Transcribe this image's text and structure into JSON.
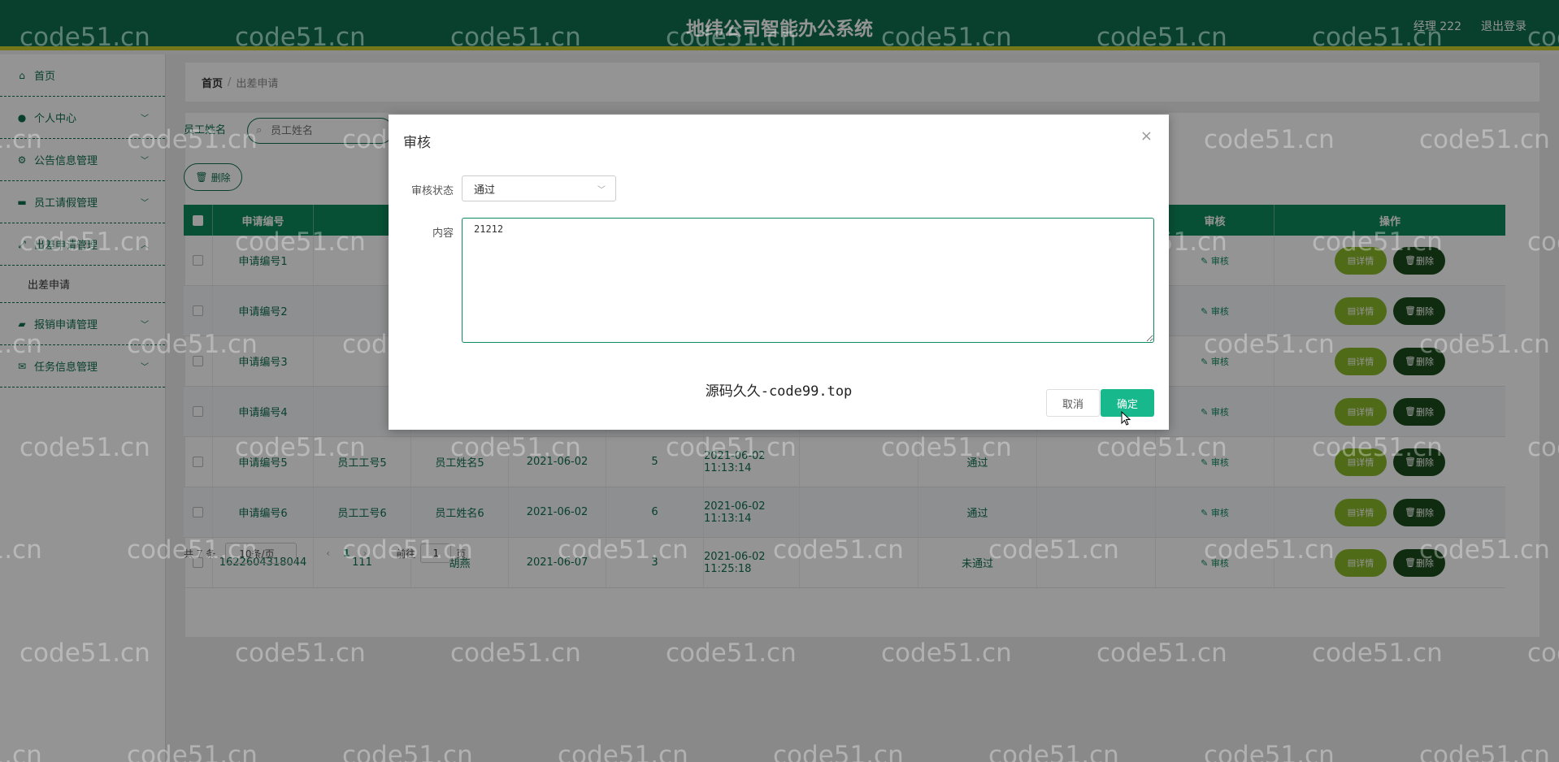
{
  "header": {
    "title": "地纬公司智能办公系统",
    "user": "经理 222",
    "logout": "退出登录"
  },
  "sidebar": {
    "items": [
      {
        "label": "首页",
        "icon": "home-icon"
      },
      {
        "label": "个人中心",
        "icon": "user-icon"
      },
      {
        "label": "公告信息管理",
        "icon": "gear-icon"
      },
      {
        "label": "员工请假管理",
        "icon": "ticket-icon"
      },
      {
        "label": "出差申请管理",
        "icon": "expand-icon"
      },
      {
        "label": "出差申请",
        "icon": ""
      },
      {
        "label": "报销申请管理",
        "icon": "chat-icon"
      },
      {
        "label": "任务信息管理",
        "icon": "mail-icon"
      }
    ]
  },
  "breadcrumb": {
    "home": "首页",
    "current": "出差申请"
  },
  "search": {
    "label": "员工姓名",
    "placeholder": "员工姓名"
  },
  "toolbar": {
    "delete_label": "删除"
  },
  "table": {
    "headers": [
      "申请编号",
      "审核",
      "操作"
    ],
    "rows": [
      {
        "no": "申请编号1",
        "emp_no": "",
        "name": "",
        "date": "",
        "days": "",
        "time": "",
        "status": ""
      },
      {
        "no": "申请编号2",
        "emp_no": "",
        "name": "",
        "date": "",
        "days": "",
        "time": "",
        "status": ""
      },
      {
        "no": "申请编号3",
        "emp_no": "",
        "name": "",
        "date": "",
        "days": "",
        "time": "",
        "status": ""
      },
      {
        "no": "申请编号4",
        "emp_no": "",
        "name": "",
        "date": "",
        "days": "",
        "time": "",
        "status": ""
      },
      {
        "no": "申请编号5",
        "emp_no": "员工工号5",
        "name": "员工姓名5",
        "date": "2021-06-02",
        "days": "5",
        "time": "2021-06-02 11:13:14",
        "status": "通过"
      },
      {
        "no": "申请编号6",
        "emp_no": "员工工号6",
        "name": "员工姓名6",
        "date": "2021-06-02",
        "days": "6",
        "time": "2021-06-02 11:13:14",
        "status": "通过"
      },
      {
        "no": "1622604318044",
        "emp_no": "111",
        "name": "胡燕",
        "date": "2021-06-07",
        "days": "3",
        "time": "2021-06-02 11:25:18",
        "status": "未通过"
      }
    ],
    "audit_link": "审核",
    "detail_label": "详情",
    "remove_label": "删除"
  },
  "pager": {
    "total": "共 7 条",
    "page_size": "10条/页",
    "prev": "‹",
    "page": "1",
    "next": "›",
    "goto": "前往",
    "goto_value": "1",
    "page_suffix": "页"
  },
  "dialog": {
    "title": "审核",
    "status_label": "审核状态",
    "status_value": "通过",
    "content_label": "内容",
    "content_value": "21212",
    "footer_text": "源码久久-code99.top",
    "cancel_label": "取消",
    "ok_label": "确定"
  },
  "watermark": "code51.cn",
  "colors": {
    "header_bg": "#0e6e4e",
    "accent_bar": "#c9cf2f",
    "table_header": "#0e8a5c",
    "detail_btn": "#8bb82a",
    "delete_btn": "#1d4d1d",
    "ok_btn": "#17b98c"
  }
}
